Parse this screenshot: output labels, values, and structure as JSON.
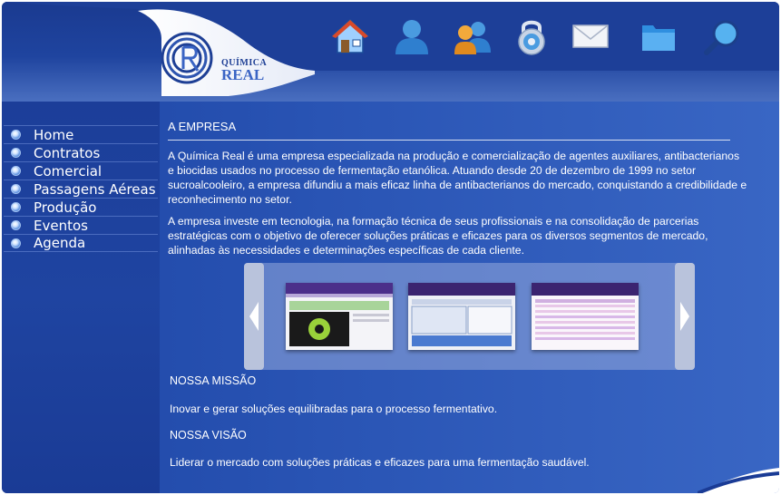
{
  "brand": {
    "name_top": "QUÍMICA",
    "name_bottom": "REAL"
  },
  "toolbar": [
    {
      "icon": "home-icon"
    },
    {
      "icon": "user-icon"
    },
    {
      "icon": "users-icon"
    },
    {
      "icon": "lock-icon"
    },
    {
      "icon": "mail-icon"
    },
    {
      "icon": "folder-icon"
    },
    {
      "icon": "search-icon"
    }
  ],
  "nav": [
    {
      "label": "Home"
    },
    {
      "label": "Contratos"
    },
    {
      "label": "Comercial"
    },
    {
      "label": "Passagens Aéreas"
    },
    {
      "label": "Produção"
    },
    {
      "label": "Eventos"
    },
    {
      "label": "Agenda"
    }
  ],
  "content": {
    "title": "A EMPRESA",
    "paragraphs": [
      "A Química Real é uma empresa especializada na produção e comercialização de agentes auxiliares, antibacterianos e biocidas usados no processo de fermentação etanólica. Atuando desde 20 de dezembro de 1999 no setor sucroalcooleiro, a empresa difundiu a mais eficaz linha de antibacterianos do mercado, conquistando a credibilidade e reconhecimento no setor.",
      "A empresa investe em tecnologia, na formação técnica de seus profissionais e na consolidação de parcerias estratégicas com o objetivo de oferecer soluções práticas e eficazes para os diversos segmentos de mercado, alinhadas às necessidades e determinações específicas de cada cliente."
    ],
    "mission_title": "NOSSA MISSÃO",
    "mission_text": "Inovar e gerar soluções equilibradas para o processo fermentativo.",
    "vision_title": "NOSSA VISÃO",
    "vision_text": "Liderar o mercado com soluções práticas e eficazes para uma fermentação saudável."
  },
  "carousel": {
    "thumbnails": [
      "screenshot-thumbnail",
      "screenshot-thumbnail",
      "screenshot-thumbnail"
    ]
  },
  "colors": {
    "background": "#2a55b5",
    "sidebar": "#1f44a1",
    "accent": "#3a64c4"
  }
}
